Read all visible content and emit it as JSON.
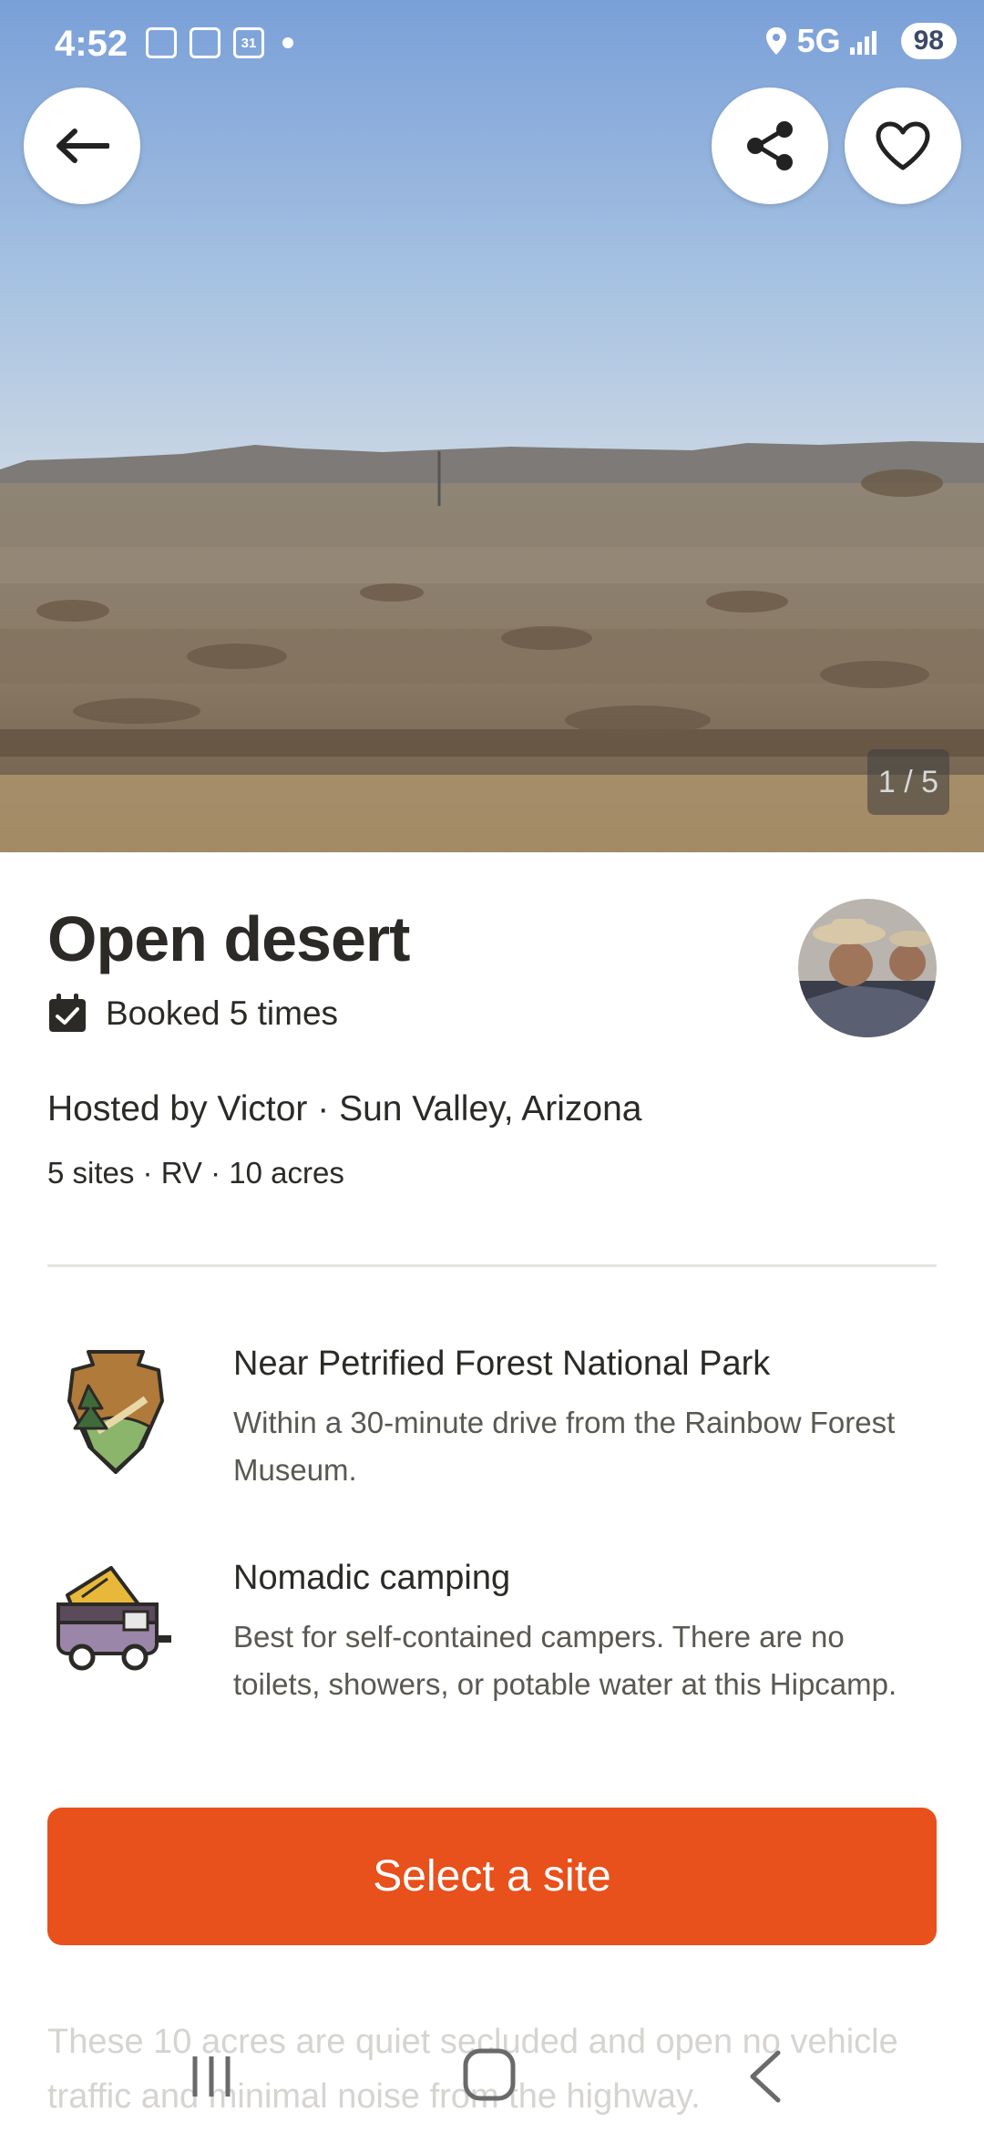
{
  "status": {
    "time": "4:52",
    "network": "5G",
    "battery": "98",
    "calendar_day": "31"
  },
  "gallery": {
    "counter": "1 / 5"
  },
  "listing": {
    "title": "Open desert",
    "booked": "Booked 5 times",
    "host_line": "Hosted by Victor · Sun Valley, Arizona",
    "meta": "5 sites · RV · 10 acres"
  },
  "features": [
    {
      "icon": "national-park-arrowhead-icon",
      "title": "Near Petrified Forest National Park",
      "desc": "Within a 30-minute drive from the Rainbow Forest Museum."
    },
    {
      "icon": "camper-van-icon",
      "title": "Nomadic camping",
      "desc": "Best for self-contained campers. There are no toilets, showers, or potable water at this Hipcamp."
    }
  ],
  "cta": {
    "label": "Select a site",
    "color": "#e8501c"
  },
  "description": "These 10 acres are quiet secluded and open no vehicle traffic and minimal noise from the highway."
}
